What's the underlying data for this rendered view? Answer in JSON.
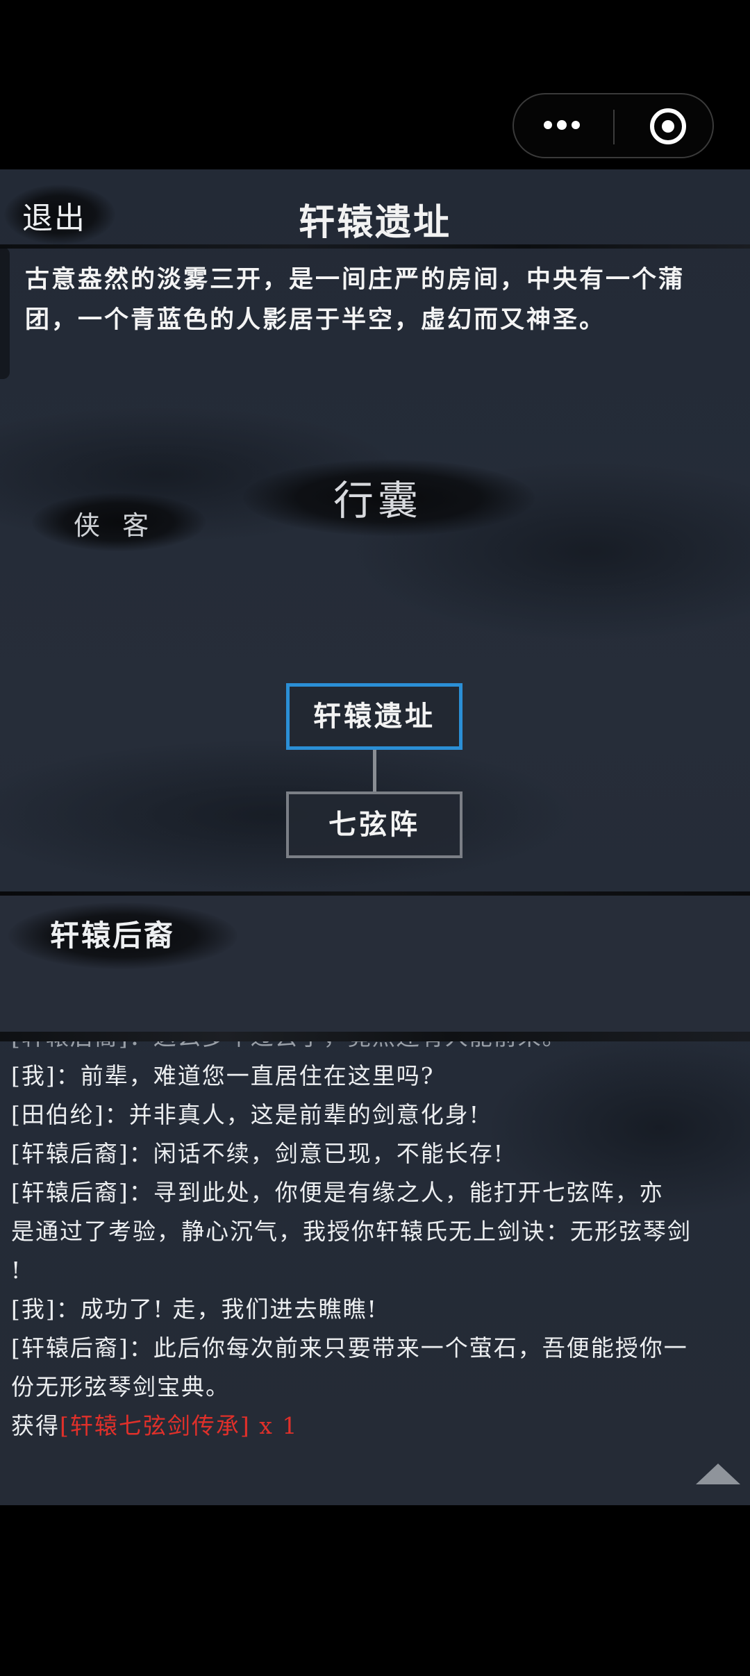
{
  "capsule": {
    "more_icon": "more-dots-icon",
    "close_icon": "target-circle-icon"
  },
  "header": {
    "exit_label": "退出",
    "title": "轩辕遗址"
  },
  "scene": {
    "description": "古意盎然的淡雾三开，是一间庄严的房间，中央有一个蒲团，一个青蓝色的人影居于半空，虚幻而又神圣。",
    "bag_label": "行囊",
    "xiake_label": "侠 客"
  },
  "map": {
    "current": "轩辕遗址",
    "child": "七弦阵",
    "active_color": "#2b8fd6"
  },
  "npc": {
    "name": "轩辕后裔"
  },
  "log": {
    "partial_line": "[轩辕后裔]：这么多年过去了，竟然还有人能前来。",
    "lines": [
      "[我]：前辈，难道您一直居住在这里吗?",
      "[田伯纶]：并非真人，这是前辈的剑意化身!",
      "[轩辕后裔]：闲话不续，剑意已现，不能长存!",
      "[轩辕后裔]：寻到此处，你便是有缘之人，能打开七弦阵，亦",
      "是通过了考验，静心沉气，我授你轩辕氏无上剑诀：无形弦琴剑",
      "!",
      "[我]：成功了! 走，我们进去瞧瞧!",
      "[轩辕后裔]：此后你每次前来只要带来一个萤石，吾便能授你一",
      "份无形弦琴剑宝典。"
    ],
    "reward_prefix": "获得",
    "reward_item": "[轩辕七弦剑传承] x 1",
    "reward_color": "#e0302a"
  },
  "scroll_icon": "scroll-up-arrow-icon"
}
